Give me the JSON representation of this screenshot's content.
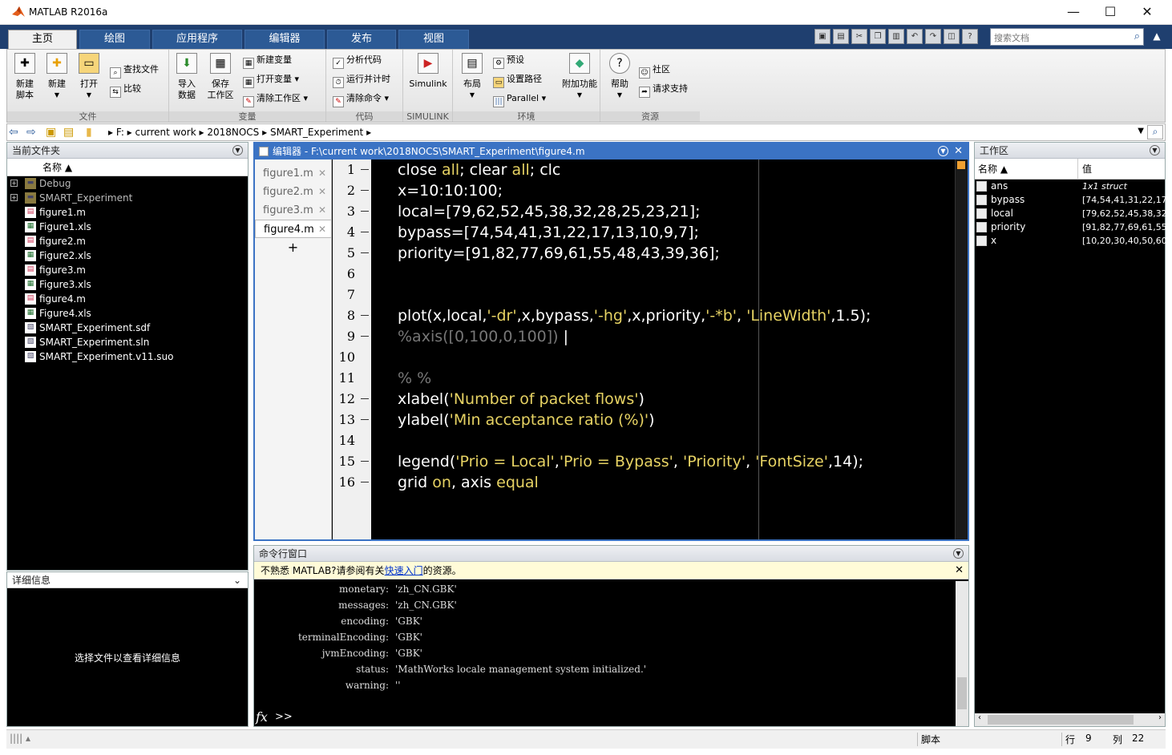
{
  "window": {
    "title": "MATLAB R2016a"
  },
  "ribbon_tabs": [
    "主页",
    "绘图",
    "应用程序",
    "编辑器",
    "发布",
    "视图"
  ],
  "search": {
    "placeholder": "搜索文档"
  },
  "ribbon": {
    "file": {
      "title": "文件",
      "new_script": "新建\n脚本",
      "new": "新建",
      "open": "打开",
      "find_files": "查找文件",
      "compare": "比较"
    },
    "variable": {
      "title": "变量",
      "import": "导入\n数据",
      "save": "保存\n工作区",
      "new_var": "新建变量",
      "open_var": "打开变量",
      "clear_ws": "清除工作区"
    },
    "code": {
      "title": "代码",
      "analyze": "分析代码",
      "run_time": "运行并计时",
      "clear_cmd": "清除命令"
    },
    "simulink": {
      "title": "SIMULINK",
      "simulink": "Simulink"
    },
    "env": {
      "title": "环境",
      "layout": "布局",
      "prefs": "预设",
      "set_path": "设置路径",
      "parallel": "Parallel",
      "addons": "附加功能"
    },
    "resources": {
      "title": "资源",
      "help": "帮助",
      "community": "社区",
      "support": "请求支持"
    }
  },
  "address": {
    "drive": "F:",
    "crumbs": [
      "current work",
      "2018NOCS",
      "SMART_Experiment"
    ]
  },
  "current_folder": {
    "title": "当前文件夹",
    "col_name": "名称 ▲",
    "items": [
      {
        "name": "Debug",
        "kind": "folder"
      },
      {
        "name": "SMART_Experiment",
        "kind": "folder"
      },
      {
        "name": "figure1.m",
        "kind": "m"
      },
      {
        "name": "Figure1.xls",
        "kind": "xls"
      },
      {
        "name": "figure2.m",
        "kind": "m"
      },
      {
        "name": "Figure2.xls",
        "kind": "xls"
      },
      {
        "name": "figure3.m",
        "kind": "m"
      },
      {
        "name": "Figure3.xls",
        "kind": "xls"
      },
      {
        "name": "figure4.m",
        "kind": "m"
      },
      {
        "name": "Figure4.xls",
        "kind": "xls"
      },
      {
        "name": "SMART_Experiment.sdf",
        "kind": "file"
      },
      {
        "name": "SMART_Experiment.sln",
        "kind": "file"
      },
      {
        "name": "SMART_Experiment.v11.suo",
        "kind": "file"
      }
    ]
  },
  "details": {
    "title": "详细信息",
    "message": "选择文件以查看详细信息"
  },
  "editor": {
    "title": "编辑器 - F:\\current work\\2018NOCS\\SMART_Experiment\\figure4.m",
    "tabs": [
      "figure1.m",
      "figure2.m",
      "figure3.m",
      "figure4.m"
    ],
    "active_tab": "figure4.m",
    "add_tab": "+",
    "line_numbers": [
      "1",
      "2",
      "3",
      "4",
      "5",
      "6",
      "7",
      "8",
      "9",
      "10",
      "11",
      "12",
      "13",
      "14",
      "15",
      "16"
    ]
  },
  "command_window": {
    "title": "命令行窗口",
    "tip_prefix": "不熟悉 MATLAB?请参阅有关",
    "tip_link": "快速入门",
    "tip_suffix": "的资源。",
    "lines": [
      {
        "key": "monetary:",
        "val": "'zh_CN.GBK'"
      },
      {
        "key": "messages:",
        "val": "'zh_CN.GBK'"
      },
      {
        "key": "encoding:",
        "val": "'GBK'"
      },
      {
        "key": "terminalEncoding:",
        "val": "'GBK'"
      },
      {
        "key": "jvmEncoding:",
        "val": "'GBK'"
      },
      {
        "key": "status:",
        "val": "'MathWorks locale management system initialized.'"
      },
      {
        "key": "warning:",
        "val": "''"
      }
    ],
    "prompt": ">>"
  },
  "workspace": {
    "title": "工作区",
    "col_name": "名称 ▲",
    "col_value": "值",
    "vars": [
      {
        "name": "ans",
        "value": "1x1 struct"
      },
      {
        "name": "bypass",
        "value": "[74,54,41,31,22,17"
      },
      {
        "name": "local",
        "value": "[79,62,52,45,38,32"
      },
      {
        "name": "priority",
        "value": "[91,82,77,69,61,55"
      },
      {
        "name": "x",
        "value": "[10,20,30,40,50,60"
      }
    ]
  },
  "statusbar": {
    "mode": "脚本",
    "row_label": "行",
    "row": "9",
    "col_label": "列",
    "col": "22"
  },
  "colors": {
    "ribbon_dark": "#1f3f6f",
    "editor_bg": "#000000",
    "string": "#e6d263",
    "comment": "#777777",
    "active_border": "#3b73c4"
  }
}
